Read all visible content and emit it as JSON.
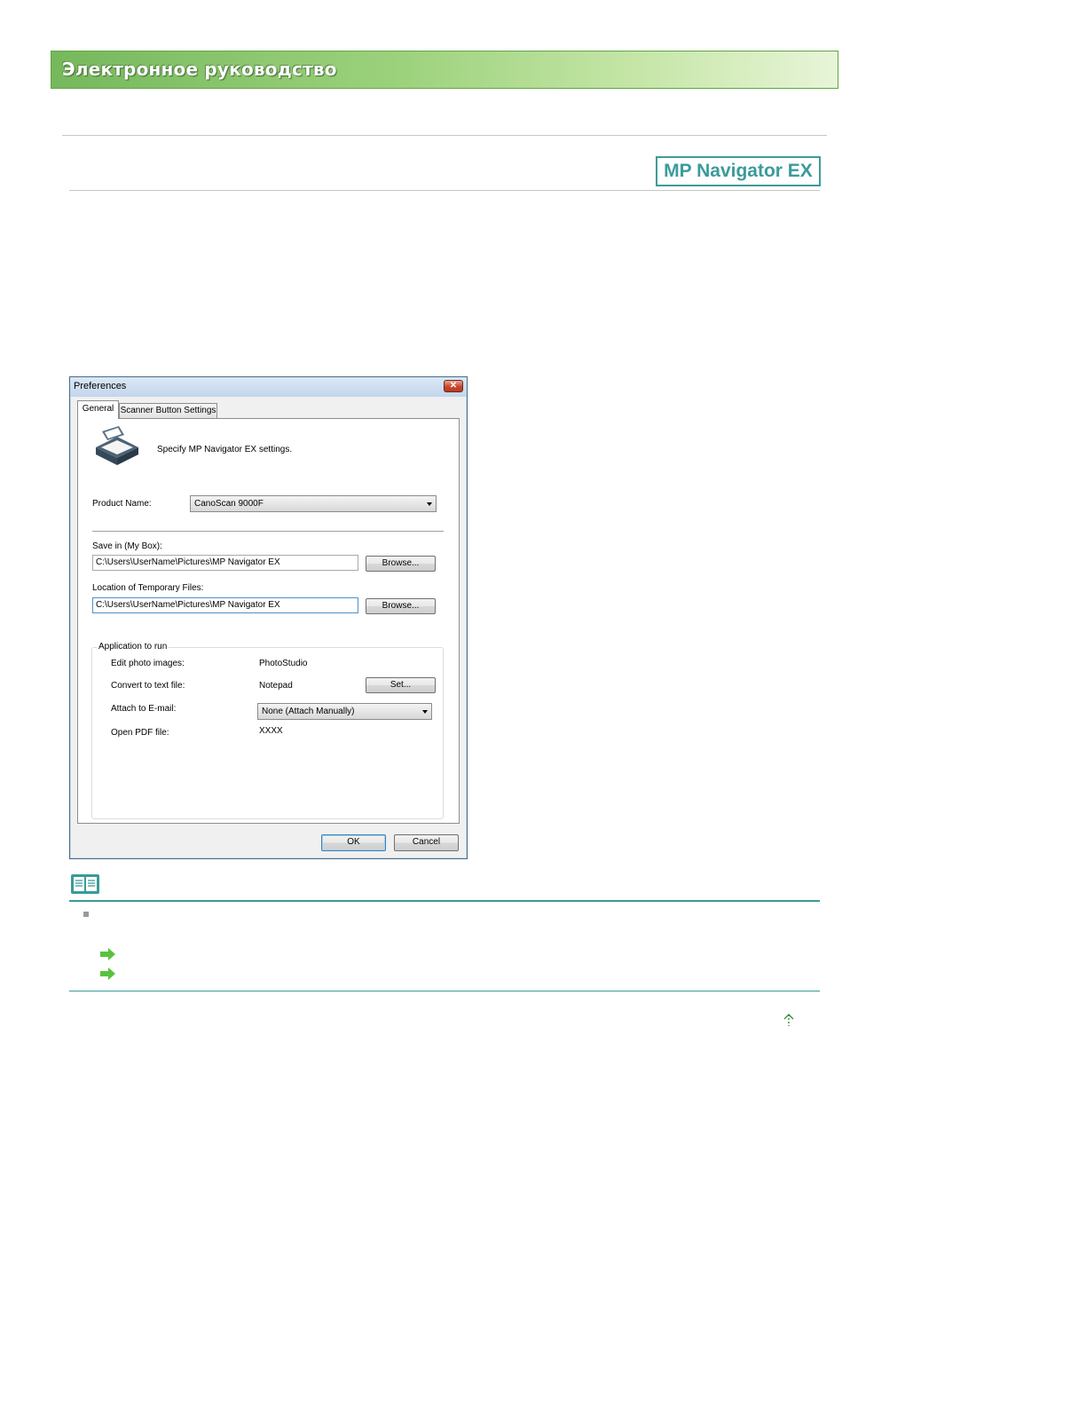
{
  "header": {
    "title": "Электронное руководство"
  },
  "product_badge": "MP Navigator EX",
  "dialog": {
    "title": "Preferences",
    "close_label": "✕",
    "tabs": [
      {
        "label": "General",
        "selected": true
      },
      {
        "label": "Scanner Button Settings",
        "selected": false
      }
    ],
    "description": "Specify MP Navigator EX settings.",
    "product_name": {
      "label": "Product Name:",
      "value": "CanoScan 9000F"
    },
    "save_in": {
      "label": "Save in (My Box):",
      "value": "C:\\Users\\UserName\\Pictures\\MP Navigator EX",
      "browse_label": "Browse..."
    },
    "temp_files": {
      "label": "Location of Temporary Files:",
      "value": "C:\\Users\\UserName\\Pictures\\MP Navigator EX",
      "browse_label": "Browse..."
    },
    "applications": {
      "group_label": "Application to run",
      "edit_photo": {
        "label": "Edit photo images:",
        "value": "PhotoStudio"
      },
      "convert_text": {
        "label": "Convert to text file:",
        "value": "Notepad",
        "set_label": "Set..."
      },
      "attach_email": {
        "label": "Attach to E-mail:",
        "value": "None (Attach Manually)"
      },
      "open_pdf": {
        "label": "Open PDF file:",
        "value": "XXXX"
      }
    },
    "ok_label": "OK",
    "cancel_label": "Cancel"
  },
  "colors": {
    "banner_green": "#9dd27d",
    "teal_accent": "#3d9a9a",
    "link_green": "#58c23e"
  }
}
